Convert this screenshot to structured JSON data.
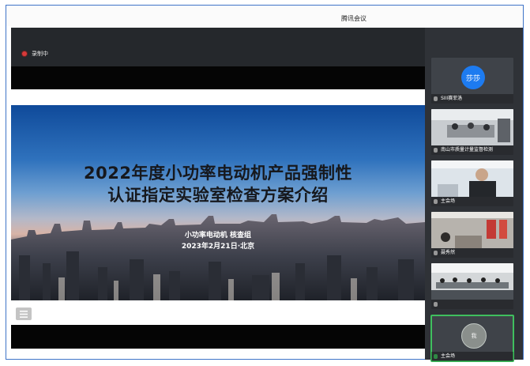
{
  "app": {
    "title": "腾讯会议"
  },
  "recording": {
    "label": "录制中"
  },
  "slide": {
    "title_line1": "2022年度小功率电动机产品强制性",
    "title_line2": "认证指定实验室检查方案介绍",
    "org": "小功率电动机 核查组",
    "date": "2023年2月21日·北京"
  },
  "participants": [
    {
      "name": "SIII赛菲洛",
      "avatar": "莎莎",
      "type": "avatar"
    },
    {
      "name": "南山市质量计量监督检测",
      "type": "camera-room"
    },
    {
      "name": "主会场",
      "type": "camera-person"
    },
    {
      "name": "聂秀然",
      "type": "camera-office"
    },
    {
      "name": "",
      "type": "camera-meeting"
    },
    {
      "name": "主会场",
      "avatar": "我",
      "type": "avatar-photo",
      "active": true
    }
  ],
  "colors": {
    "accent_blue": "#1d7bf0",
    "speaking_green": "#3fbf5e",
    "record_red": "#d83a3a"
  }
}
